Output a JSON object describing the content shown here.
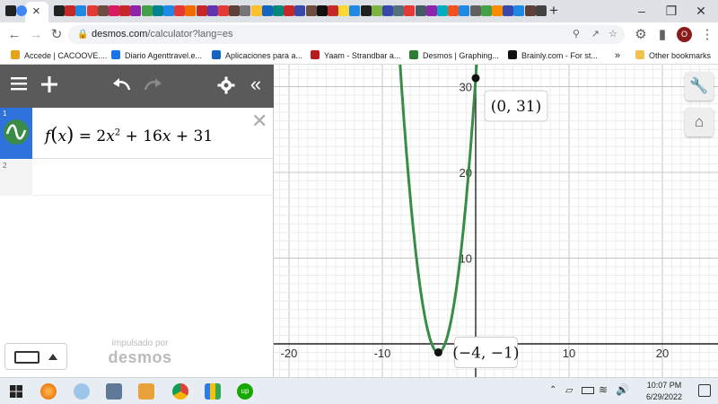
{
  "browser": {
    "url_host": "desmos.com",
    "url_path": "/calculator?lang=es",
    "tab_close": "×",
    "new_tab": "+",
    "bookmarks": [
      {
        "label": "Accede | CACOOVE....",
        "color": "#e3a21a"
      },
      {
        "label": "Diario Agenttravel.e...",
        "color": "#1a73e8"
      },
      {
        "label": "Aplicaciones para a...",
        "color": "#1565c0"
      },
      {
        "label": "Yaam - Strandbar a...",
        "color": "#b71c1c"
      },
      {
        "label": "Desmos | Graphing...",
        "color": "#2e7d32"
      },
      {
        "label": "Brainly.com - For st...",
        "color": "#111111"
      }
    ],
    "bookmarks_more": "»",
    "other_bookmarks": "Other bookmarks",
    "profile_initial": "O"
  },
  "desmos": {
    "expressions": [
      {
        "index": "1",
        "latex_parts": {
          "f": "f",
          "x": "x",
          "coef_a": "2",
          "exp": "2",
          "coef_b": "16",
          "c": "31"
        }
      },
      {
        "index": "2"
      }
    ],
    "watermark_line1": "impulsado por",
    "watermark_line2": "desmos",
    "colors": {
      "curve": "#388c46",
      "toolbar": "#5a5a5a",
      "selected": "#2f72dc"
    }
  },
  "graph": {
    "x_ticks": [
      "-20",
      "-10",
      "10",
      "20"
    ],
    "y_ticks": [
      "10",
      "20",
      "30"
    ],
    "points": [
      {
        "label": "(0, 31)",
        "x": 0,
        "y": 31
      },
      {
        "label": "(−4, −1)",
        "x": -4,
        "y": -1
      }
    ],
    "function": {
      "a": 2,
      "b": 16,
      "c": 31
    }
  },
  "taskbar": {
    "time": "10:07 PM",
    "date": "6/29/2022"
  }
}
